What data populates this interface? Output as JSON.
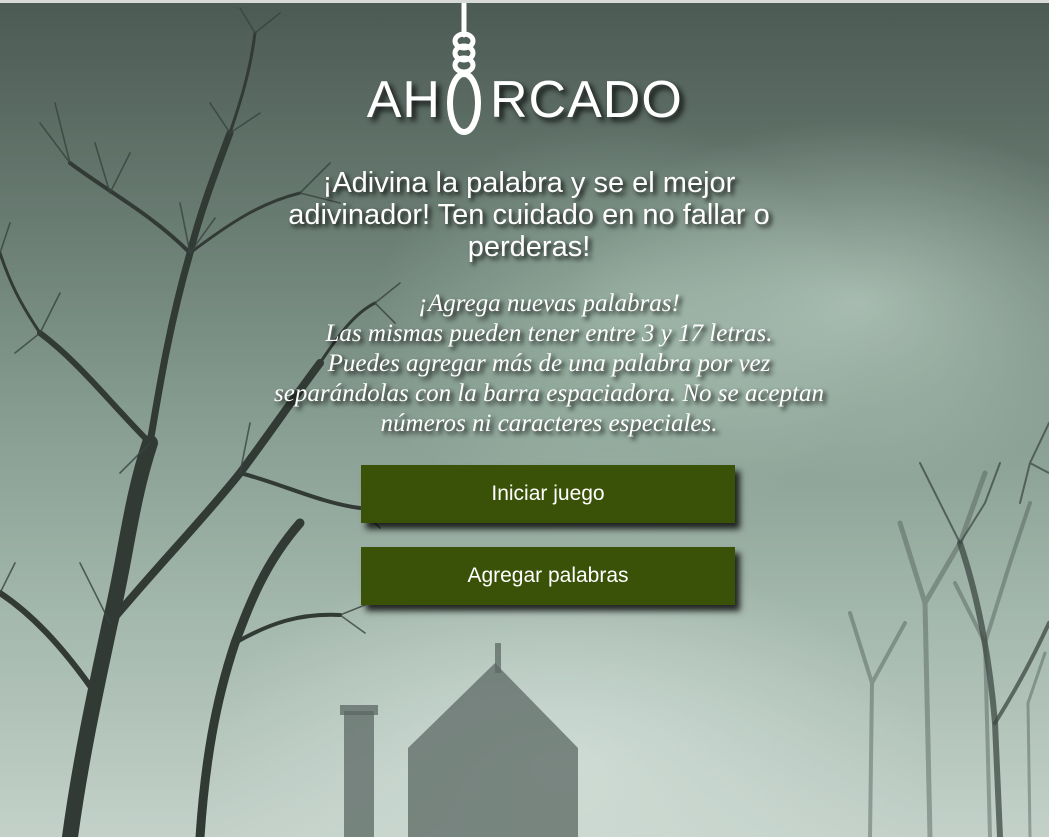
{
  "app": {
    "title_before": "AH",
    "title_after": "RCADO",
    "title_icon": "noose-icon"
  },
  "intro": {
    "tagline": "¡Adivina la palabra y se el mejor adivinador! Ten cuidado en no fallar o perderas!",
    "info_lines": [
      "¡Agrega nuevas palabras!",
      "Las mismas pueden tener entre 3 y 17 letras.",
      "Puedes agregar más de una palabra por vez separándolas con la barra espaciadora. No se aceptan números ni caracteres especiales."
    ]
  },
  "buttons": {
    "start_label": "Iniciar juego",
    "add_words_label": "Agregar palabras"
  },
  "colors": {
    "button_bg": "#3a5208",
    "text": "#ffffff"
  }
}
